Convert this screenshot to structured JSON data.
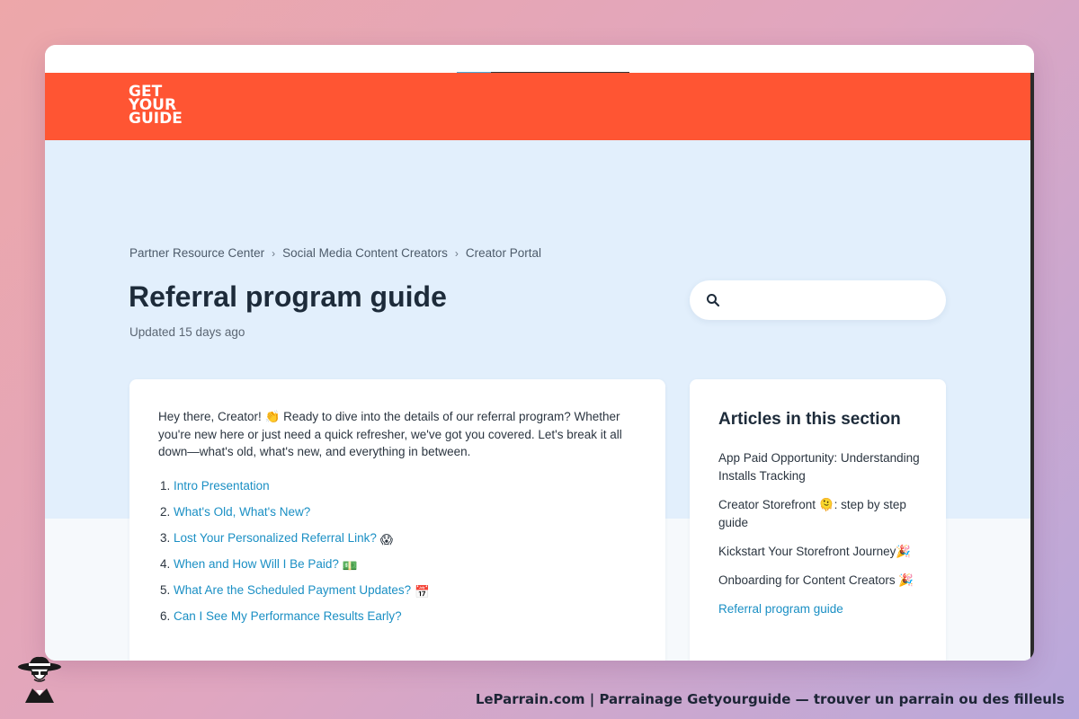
{
  "header": {
    "logo_lines": [
      "GET",
      "YOUR",
      "GUIDE"
    ],
    "brand_color": "#ff5533"
  },
  "breadcrumb": [
    "Partner Resource Center",
    "Social Media Content Creators",
    "Creator Portal"
  ],
  "breadcrumb_separator": "›",
  "article": {
    "title": "Referral program guide",
    "updated": "Updated 15 days ago",
    "intro": "Hey there, Creator! 👏 Ready to dive into the details of our referral program? Whether you're new here or just need a quick refresher, we've got you covered. Let's break it all down—what's old, what's new, and everything in between.",
    "toc": [
      {
        "num": "1.",
        "label": "Intro Presentation",
        "emoji": ""
      },
      {
        "num": "2.",
        "label": "What's Old, What's New?",
        "emoji": ""
      },
      {
        "num": "3.",
        "label": "Lost Your Personalized Referral Link?",
        "emoji": "😱"
      },
      {
        "num": "4.",
        "label": "When and How Will I Be Paid?",
        "emoji": "💵"
      },
      {
        "num": "5.",
        "label": "What Are the Scheduled Payment Updates?",
        "emoji": "📅"
      },
      {
        "num": "6.",
        "label": "Can I See My Performance Results Early?",
        "emoji": ""
      }
    ]
  },
  "search": {
    "placeholder": ""
  },
  "sidebar": {
    "heading": "Articles in this section",
    "items": [
      {
        "label": "App Paid Opportunity: Understanding Installs Tracking",
        "active": false
      },
      {
        "label": "Creator Storefront 🫠: step by step guide",
        "active": false
      },
      {
        "label": "Kickstart Your Storefront Journey🎉",
        "active": false
      },
      {
        "label": "Onboarding for Content Creators 🎉",
        "active": false
      },
      {
        "label": "Referral program guide",
        "active": true
      }
    ]
  },
  "footer": {
    "caption": "LeParrain.com | Parrainage Getyourguide — trouver un parrain ou des filleuls"
  },
  "colors": {
    "link": "#1a8fc4",
    "hero_bg": "#e2effc",
    "title": "#1d2b3a"
  }
}
